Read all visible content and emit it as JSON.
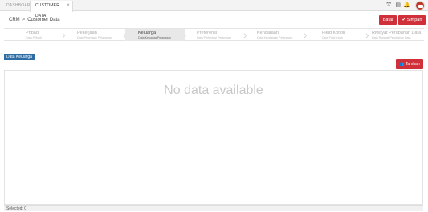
{
  "tabs": [
    {
      "label": "DASHBOARD"
    },
    {
      "label": "CUSTOMER DATA",
      "close": "×"
    }
  ],
  "breadcrumb": {
    "root": "CRM",
    "separator": ">",
    "current": "Customer Data"
  },
  "header": {
    "batal_label": "Batal",
    "simpan_label": "Simpan",
    "simpan_icon": "✔"
  },
  "icons": {
    "expand": "⤧",
    "grid": "▤",
    "bell": "🔔"
  },
  "steps": [
    {
      "title": "Pribadi",
      "subtitle": "Data Pribadi"
    },
    {
      "title": "Pekerjaan",
      "subtitle": "Data Pekerjaan Pelanggan"
    },
    {
      "title": "Keluarga",
      "subtitle": "Data Keluarga Pelanggan"
    },
    {
      "title": "Preferensi",
      "subtitle": "Data Preferensi Pelanggan"
    },
    {
      "title": "Kendaraan",
      "subtitle": "Data Kendaraan Pelanggan"
    },
    {
      "title": "Field Kotion",
      "subtitle": "Data Field Induk"
    },
    {
      "title": "Riwayat Perubahan Data",
      "subtitle": "Data Riwayat Perubahan Data"
    }
  ],
  "section": {
    "label": "Data Keluarga",
    "add_label": "Tambah",
    "add_icon": "👥"
  },
  "grid": {
    "empty_text": "No data available"
  },
  "footer": {
    "selected_text": "Selected: 0"
  },
  "colors": {
    "accent_red": "#d0303a",
    "section_blue": "#2e6da4"
  }
}
